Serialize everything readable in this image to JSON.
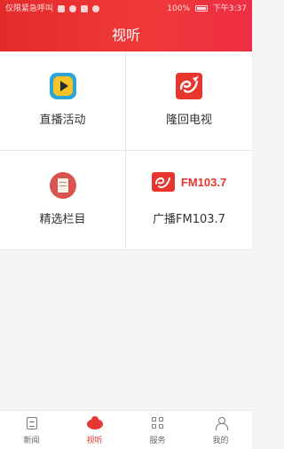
{
  "status_bar": {
    "left_text": "仅限紧急呼叫",
    "battery_text": "100%",
    "time": "下午3:37"
  },
  "header": {
    "title": "视听"
  },
  "grid": [
    {
      "label": "直播活动",
      "icon": "play-icon"
    },
    {
      "label": "隆回电视",
      "icon": "longhui-tv-logo-icon"
    },
    {
      "label": "精选栏目",
      "icon": "document-icon"
    },
    {
      "label": "广播FM103.7",
      "icon": "fm-logo-icon",
      "logo_text": "FM103.7"
    }
  ],
  "bottom_nav": [
    {
      "label": "新闻",
      "icon": "news-icon",
      "active": false
    },
    {
      "label": "视听",
      "icon": "video-icon",
      "active": true
    },
    {
      "label": "服务",
      "icon": "grid-icon",
      "active": false
    },
    {
      "label": "我的",
      "icon": "user-icon",
      "active": false
    }
  ],
  "colors": {
    "header": "#e52a2a",
    "accent": "#e53935",
    "background": "#f4f4f4"
  }
}
